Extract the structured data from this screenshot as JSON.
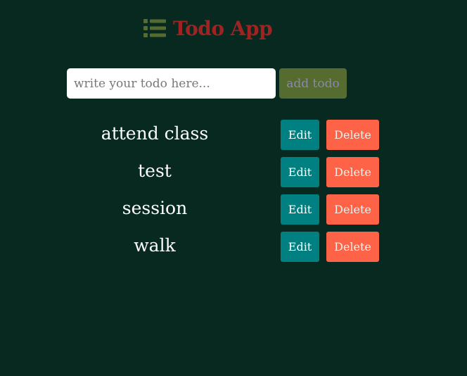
{
  "header": {
    "icon": "list-icon",
    "title": "Todo App"
  },
  "form": {
    "input_value": "",
    "placeholder": "write your todo here...",
    "add_label": "add todo"
  },
  "todos": [
    {
      "text": "attend class",
      "edit_label": "Edit",
      "delete_label": "Delete"
    },
    {
      "text": "test",
      "edit_label": "Edit",
      "delete_label": "Delete"
    },
    {
      "text": "session",
      "edit_label": "Edit",
      "delete_label": "Delete"
    },
    {
      "text": "walk",
      "edit_label": "Edit",
      "delete_label": "Delete"
    }
  ],
  "colors": {
    "background": "#072920",
    "title": "#a02322",
    "icon": "#556b2f",
    "add_button": "#556b2f",
    "add_button_text": "#8a88b0",
    "edit_button": "#008080",
    "delete_button": "#ff6347",
    "todo_text": "#ffffff"
  }
}
